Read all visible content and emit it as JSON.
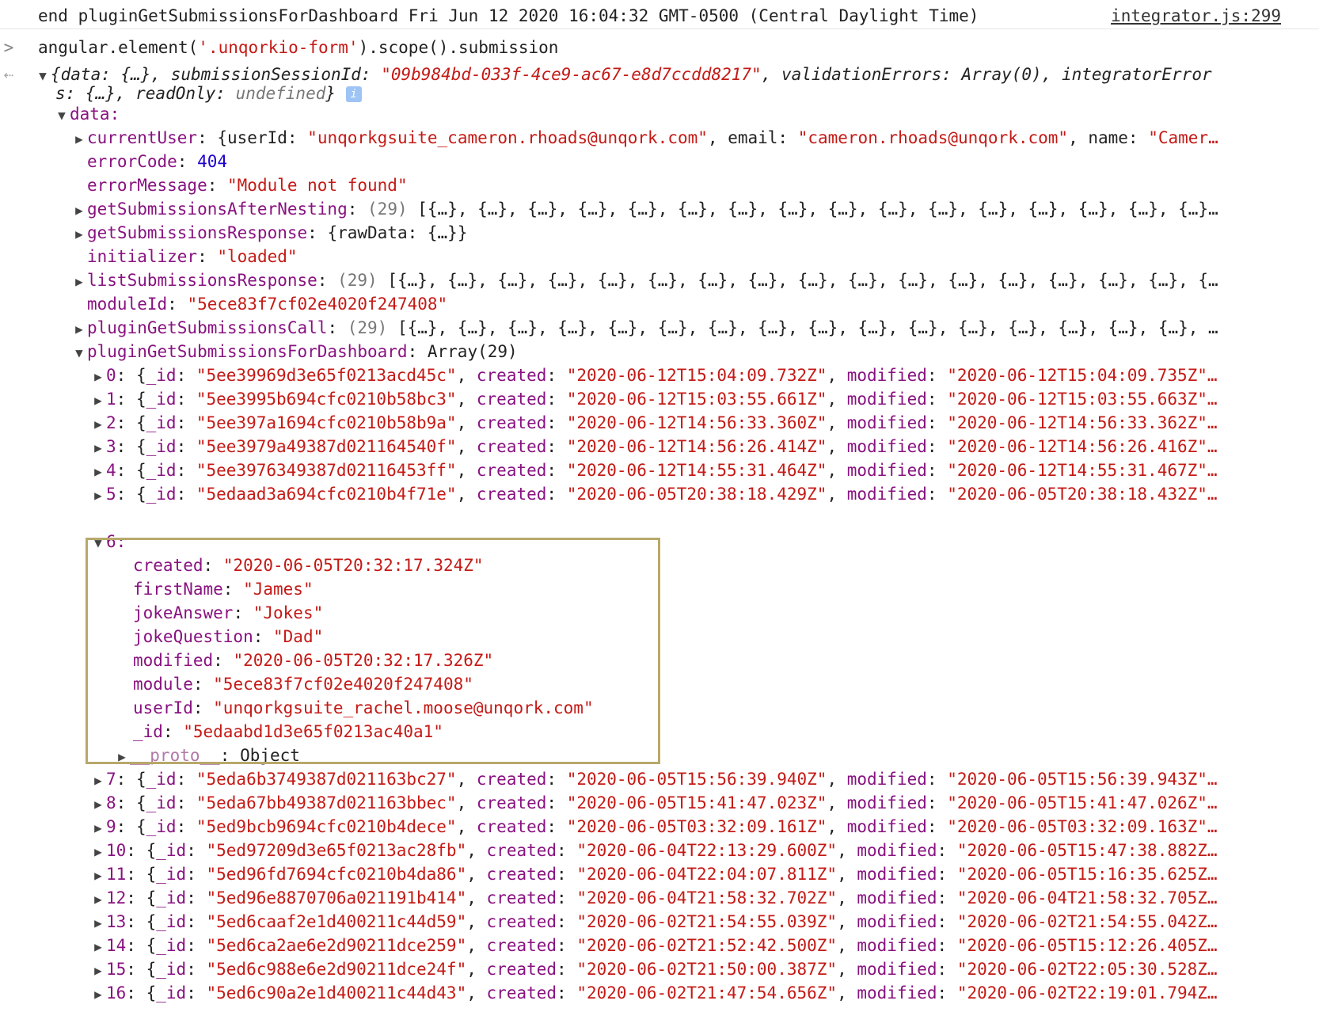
{
  "log_line": {
    "text": "end pluginGetSubmissionsForDashboard Fri Jun 12 2020 16:04:32 GMT-0500 (Central Daylight Time)",
    "source": "integrator.js:299"
  },
  "command": {
    "prompt": ">",
    "text_a": "angular.element(",
    "text_b": "'.unqorkio-form'",
    "text_c": ").scope().submission"
  },
  "result": {
    "prefix": "{data: {…}, submissionSessionId: ",
    "session_id": "\"09b984bd-033f-4ce9-ac67-e8d7ccdd8217\"",
    "mid": ", validationErrors: Array(0), integratorError",
    "line2_a": "s: {…}, readOnly: ",
    "line2_b": "undefined",
    "line2_c": "}"
  },
  "data_key": "data:",
  "fields": {
    "currentUser_key": "currentUser",
    "currentUser_a": "{userId: ",
    "currentUser_uid": "\"unqorkgsuite_cameron.rhoads@unqork.com\"",
    "currentUser_b": ", email: ",
    "currentUser_email": "\"cameron.rhoads@unqork.com\"",
    "currentUser_c": ", name: ",
    "currentUser_name": "\"Camer…",
    "errorCode_key": "errorCode",
    "errorCode_val": "404",
    "errorMessage_key": "errorMessage",
    "errorMessage_val": "\"Module not found\"",
    "gsan_key": "getSubmissionsAfterNesting",
    "gsan_count": "(29)",
    "gsan_val": "[{…}, {…}, {…}, {…}, {…}, {…}, {…}, {…}, {…}, {…}, {…}, {…}, {…}, {…}, {…}, {…}…",
    "gsr_key": "getSubmissionsResponse",
    "gsr_val": "{rawData: {…}}",
    "init_key": "initializer",
    "init_val": "\"loaded\"",
    "lsr_key": "listSubmissionsResponse",
    "lsr_count": "(29)",
    "lsr_val": "[{…}, {…}, {…}, {…}, {…}, {…}, {…}, {…}, {…}, {…}, {…}, {…}, {…}, {…}, {…}, {…}, {…",
    "moduleId_key": "moduleId",
    "moduleId_val": "\"5ece83f7cf02e4020f247408\"",
    "pgsc_key": "pluginGetSubmissionsCall",
    "pgsc_count": "(29)",
    "pgsc_val": "[{…}, {…}, {…}, {…}, {…}, {…}, {…}, {…}, {…}, {…}, {…}, {…}, {…}, {…}, {…}, {…}, …",
    "pgsfd_key": "pluginGetSubmissionsForDashboard",
    "pgsfd_val": "Array(29)"
  },
  "rows_top": [
    {
      "idx": "0",
      "id": "\"5ee39969d3e65f0213acd45c\"",
      "created": "\"2020-06-12T15:04:09.732Z\"",
      "modified": "\"2020-06-12T15:04:09.735Z\"…"
    },
    {
      "idx": "1",
      "id": "\"5ee3995b694cfc0210b58bc3\"",
      "created": "\"2020-06-12T15:03:55.661Z\"",
      "modified": "\"2020-06-12T15:03:55.663Z\"…"
    },
    {
      "idx": "2",
      "id": "\"5ee397a1694cfc0210b58b9a\"",
      "created": "\"2020-06-12T14:56:33.360Z\"",
      "modified": "\"2020-06-12T14:56:33.362Z\"…"
    },
    {
      "idx": "3",
      "id": "\"5ee3979a49387d021164540f\"",
      "created": "\"2020-06-12T14:56:26.414Z\"",
      "modified": "\"2020-06-12T14:56:26.416Z\"…"
    },
    {
      "idx": "4",
      "id": "\"5ee3976349387d02116453ff\"",
      "created": "\"2020-06-12T14:55:31.464Z\"",
      "modified": "\"2020-06-12T14:55:31.467Z\"…"
    },
    {
      "idx": "5",
      "id": "\"5edaad3a694cfc0210b4f71e\"",
      "created": "\"2020-06-05T20:38:18.429Z\"",
      "modified": "\"2020-06-05T20:38:18.432Z\"…"
    }
  ],
  "expanded": {
    "idx": "6:",
    "created_key": "created",
    "created_val": "\"2020-06-05T20:32:17.324Z\"",
    "firstName_key": "firstName",
    "firstName_val": "\"James\"",
    "jokeAnswer_key": "jokeAnswer",
    "jokeAnswer_val": "\"Jokes\"",
    "jokeQuestion_key": "jokeQuestion",
    "jokeQuestion_val": "\"Dad\"",
    "modified_key": "modified",
    "modified_val": "\"2020-06-05T20:32:17.326Z\"",
    "module_key": "module",
    "module_val": "\"5ece83f7cf02e4020f247408\"",
    "userId_key": "userId",
    "userId_val": "\"unqorkgsuite_rachel.moose@unqork.com\"",
    "id_key": "_id",
    "id_val": "\"5edaabd1d3e65f0213ac40a1\"",
    "proto_key": "__proto__",
    "proto_val": "Object"
  },
  "rows_bottom": [
    {
      "idx": "7",
      "id": "\"5eda6b3749387d021163bc27\"",
      "created": "\"2020-06-05T15:56:39.940Z\"",
      "modified": "\"2020-06-05T15:56:39.943Z\"…"
    },
    {
      "idx": "8",
      "id": "\"5eda67bb49387d021163bbec\"",
      "created": "\"2020-06-05T15:41:47.023Z\"",
      "modified": "\"2020-06-05T15:41:47.026Z\"…"
    },
    {
      "idx": "9",
      "id": "\"5ed9bcb9694cfc0210b4dece\"",
      "created": "\"2020-06-05T03:32:09.161Z\"",
      "modified": "\"2020-06-05T03:32:09.163Z\"…"
    },
    {
      "idx": "10",
      "id": "\"5ed97209d3e65f0213ac28fb\"",
      "created": "\"2020-06-04T22:13:29.600Z\"",
      "modified": "\"2020-06-05T15:47:38.882Z…"
    },
    {
      "idx": "11",
      "id": "\"5ed96fd7694cfc0210b4da86\"",
      "created": "\"2020-06-04T22:04:07.811Z\"",
      "modified": "\"2020-06-05T15:16:35.625Z…"
    },
    {
      "idx": "12",
      "id": "\"5ed96e8870706a021191b414\"",
      "created": "\"2020-06-04T21:58:32.702Z\"",
      "modified": "\"2020-06-04T21:58:32.705Z…"
    },
    {
      "idx": "13",
      "id": "\"5ed6caaf2e1d400211c44d59\"",
      "created": "\"2020-06-02T21:54:55.039Z\"",
      "modified": "\"2020-06-02T21:54:55.042Z…"
    },
    {
      "idx": "14",
      "id": "\"5ed6ca2ae6e2d90211dce259\"",
      "created": "\"2020-06-02T21:52:42.500Z\"",
      "modified": "\"2020-06-05T15:12:26.405Z…"
    },
    {
      "idx": "15",
      "id": "\"5ed6c988e6e2d90211dce24f\"",
      "created": "\"2020-06-02T21:50:00.387Z\"",
      "modified": "\"2020-06-02T22:05:30.528Z…"
    },
    {
      "idx": "16",
      "id": "\"5ed6c90a2e1d400211c44d43\"",
      "created": "\"2020-06-02T21:47:54.656Z\"",
      "modified": "\"2020-06-02T22:19:01.794Z…"
    }
  ],
  "labels": {
    "id_key": "_id",
    "created_key": "created",
    "modified_key": "modified",
    "colon_space": ": ",
    "comma_space": ", ",
    "open_brace": "{",
    "colon": ":"
  }
}
